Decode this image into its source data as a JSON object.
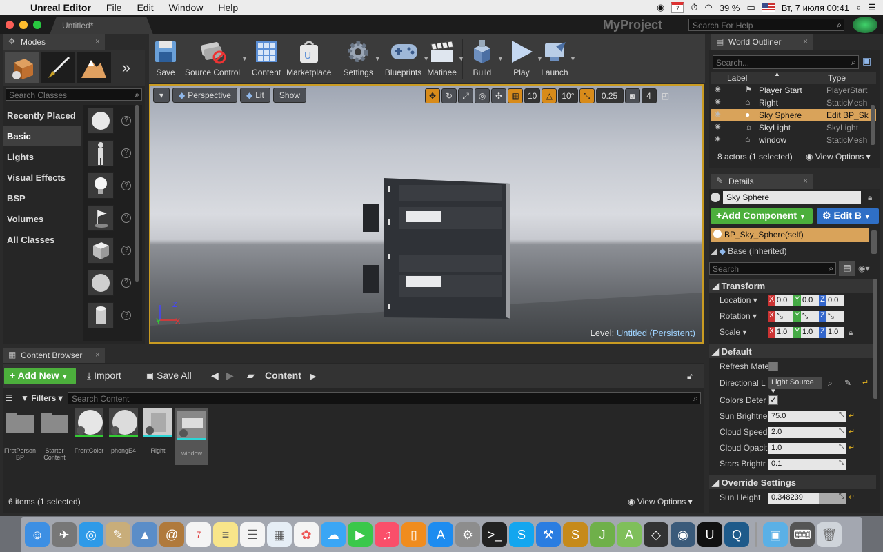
{
  "menubar": {
    "app_name": "Unreal Editor",
    "menus": [
      "File",
      "Edit",
      "Window",
      "Help"
    ],
    "calendar_day": "7",
    "battery": "39 %",
    "datetime": "Вт, 7 июля  00:41"
  },
  "titlebar": {
    "tab": "Untitled*",
    "project": "MyProject",
    "help_search_placeholder": "Search For Help"
  },
  "modes": {
    "tab": "Modes",
    "search_placeholder": "Search Classes",
    "categories": [
      "Recently Placed",
      "Basic",
      "Lights",
      "Visual Effects",
      "BSP",
      "Volumes",
      "All Classes"
    ],
    "active_category": "Basic"
  },
  "toolbar": {
    "buttons": [
      "Save",
      "Source Control",
      "Content",
      "Marketplace",
      "Settings",
      "Blueprints",
      "Matinee",
      "Build",
      "Play",
      "Launch"
    ]
  },
  "viewport": {
    "perspective": "Perspective",
    "lit": "Lit",
    "show": "Show",
    "grid_snap": "10",
    "rot_snap": "10°",
    "scale_snap": "0.25",
    "cam_speed": "4",
    "level_label": "Level:",
    "level_name": "Untitled (Persistent)",
    "axis_x": "X",
    "axis_y": "Y",
    "axis_z": "Z"
  },
  "outliner": {
    "tab": "World Outliner",
    "search_placeholder": "Search...",
    "col_label": "Label",
    "col_type": "Type",
    "rows": [
      {
        "label": "Player Start",
        "type": "PlayerStart"
      },
      {
        "label": "Right",
        "type": "StaticMesh"
      },
      {
        "label": "Sky Sphere",
        "type": "Edit BP_Sk"
      },
      {
        "label": "SkyLight",
        "type": "SkyLight"
      },
      {
        "label": "window",
        "type": "StaticMesh"
      }
    ],
    "status": "8 actors (1 selected)",
    "view_options": "View Options"
  },
  "details": {
    "tab": "Details",
    "name": "Sky Sphere",
    "add_component": "Add Component",
    "edit_bp": "Edit B",
    "component_self": "BP_Sky_Sphere(self)",
    "component_base": "Base (Inherited)",
    "search_placeholder": "Search",
    "transform_header": "Transform",
    "location_label": "Location",
    "rotation_label": "Rotation",
    "scale_label": "Scale",
    "location": [
      "0.0",
      "0.0",
      "0.0"
    ],
    "scale": [
      "1.0",
      "1.0",
      "1.0"
    ],
    "default_header": "Default",
    "props": {
      "refresh": "Refresh Mate",
      "directional": "Directional L",
      "directional_value": "Light Source",
      "colors": "Colors Deter",
      "sun_brightness": "Sun Brightne",
      "sun_brightness_value": "75.0",
      "cloud_speed": "Cloud Speed",
      "cloud_speed_value": "2.0",
      "cloud_opacity": "Cloud Opacit",
      "cloud_opacity_value": "1.0",
      "stars": "Stars Brightr",
      "stars_value": "0.1"
    },
    "override_header": "Override Settings",
    "sun_height": "Sun Height",
    "sun_height_value": "0.348239"
  },
  "content_browser": {
    "tab": "Content Browser",
    "add_new": "Add New",
    "import": "Import",
    "save_all": "Save All",
    "path": "Content",
    "filters": "Filters",
    "search_placeholder": "Search Content",
    "assets": [
      "FirstPerson BP",
      "Starter Content",
      "FrontColor",
      "phongE4",
      "Right",
      "window"
    ],
    "status": "6 items (1 selected)",
    "view_options": "View Options"
  }
}
